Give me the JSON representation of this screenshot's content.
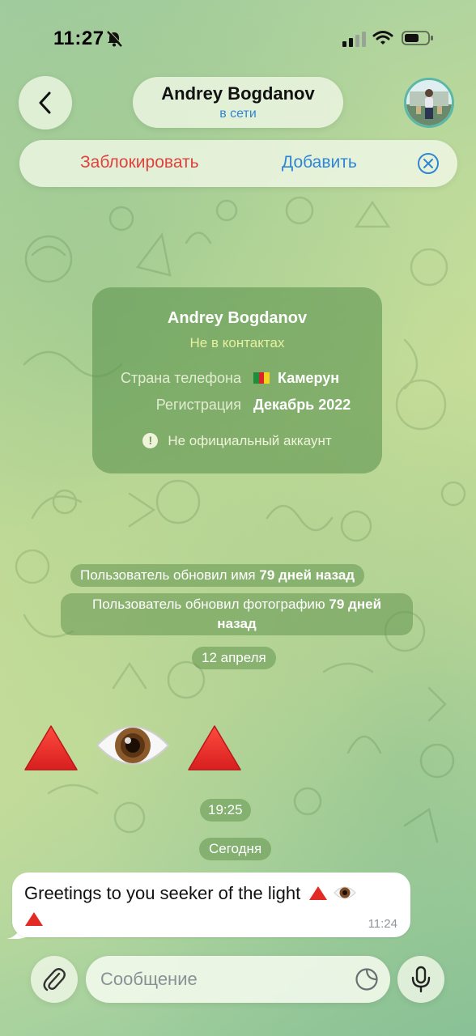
{
  "status_bar": {
    "time": "11:27",
    "icons": [
      "bell-muted-icon",
      "signal-icon",
      "wifi-icon",
      "battery-icon"
    ]
  },
  "header": {
    "back_icon": "chevron-left-icon",
    "name": "Andrey Bogdanov",
    "status": "в сети",
    "status_color": "#2f86d4"
  },
  "action_bar": {
    "block_label": "Заблокировать",
    "block_color": "#e0413c",
    "add_label": "Добавить",
    "add_color": "#2f86d4",
    "close_icon": "close-circle-icon"
  },
  "info_card": {
    "name": "Andrey Bogdanov",
    "subtitle": "Не в контактах",
    "rows": [
      {
        "label": "Страна телефона",
        "value": "Камерун",
        "flag": "cameroon-flag-icon"
      },
      {
        "label": "Регистрация",
        "value": "Декабрь 2022"
      }
    ],
    "note": "Не официальный аккаунт",
    "note_icon": "exclamation-icon"
  },
  "system_messages": {
    "name_update_prefix": "Пользователь обновил имя",
    "name_update_bold": "79 дней назад",
    "photo_update_prefix": "Пользователь обновил фотографию",
    "photo_update_bold_line1": "79 дней",
    "photo_update_bold_line2": "назад",
    "date_1": "12 апреля",
    "time_1": "19:25",
    "date_2": "Сегодня"
  },
  "emoji_message": [
    "red-triangle-icon",
    "eye-icon",
    "red-triangle-icon"
  ],
  "incoming_message": {
    "text": "Greetings to you seeker of the light",
    "trailing_emoji": [
      "red-triangle-icon",
      "eye-icon",
      "red-triangle-icon"
    ],
    "time": "11:24"
  },
  "input_bar": {
    "attach_icon": "paperclip-icon",
    "placeholder": "Сообщение",
    "sticker_icon": "sticker-icon",
    "mic_icon": "microphone-icon"
  }
}
